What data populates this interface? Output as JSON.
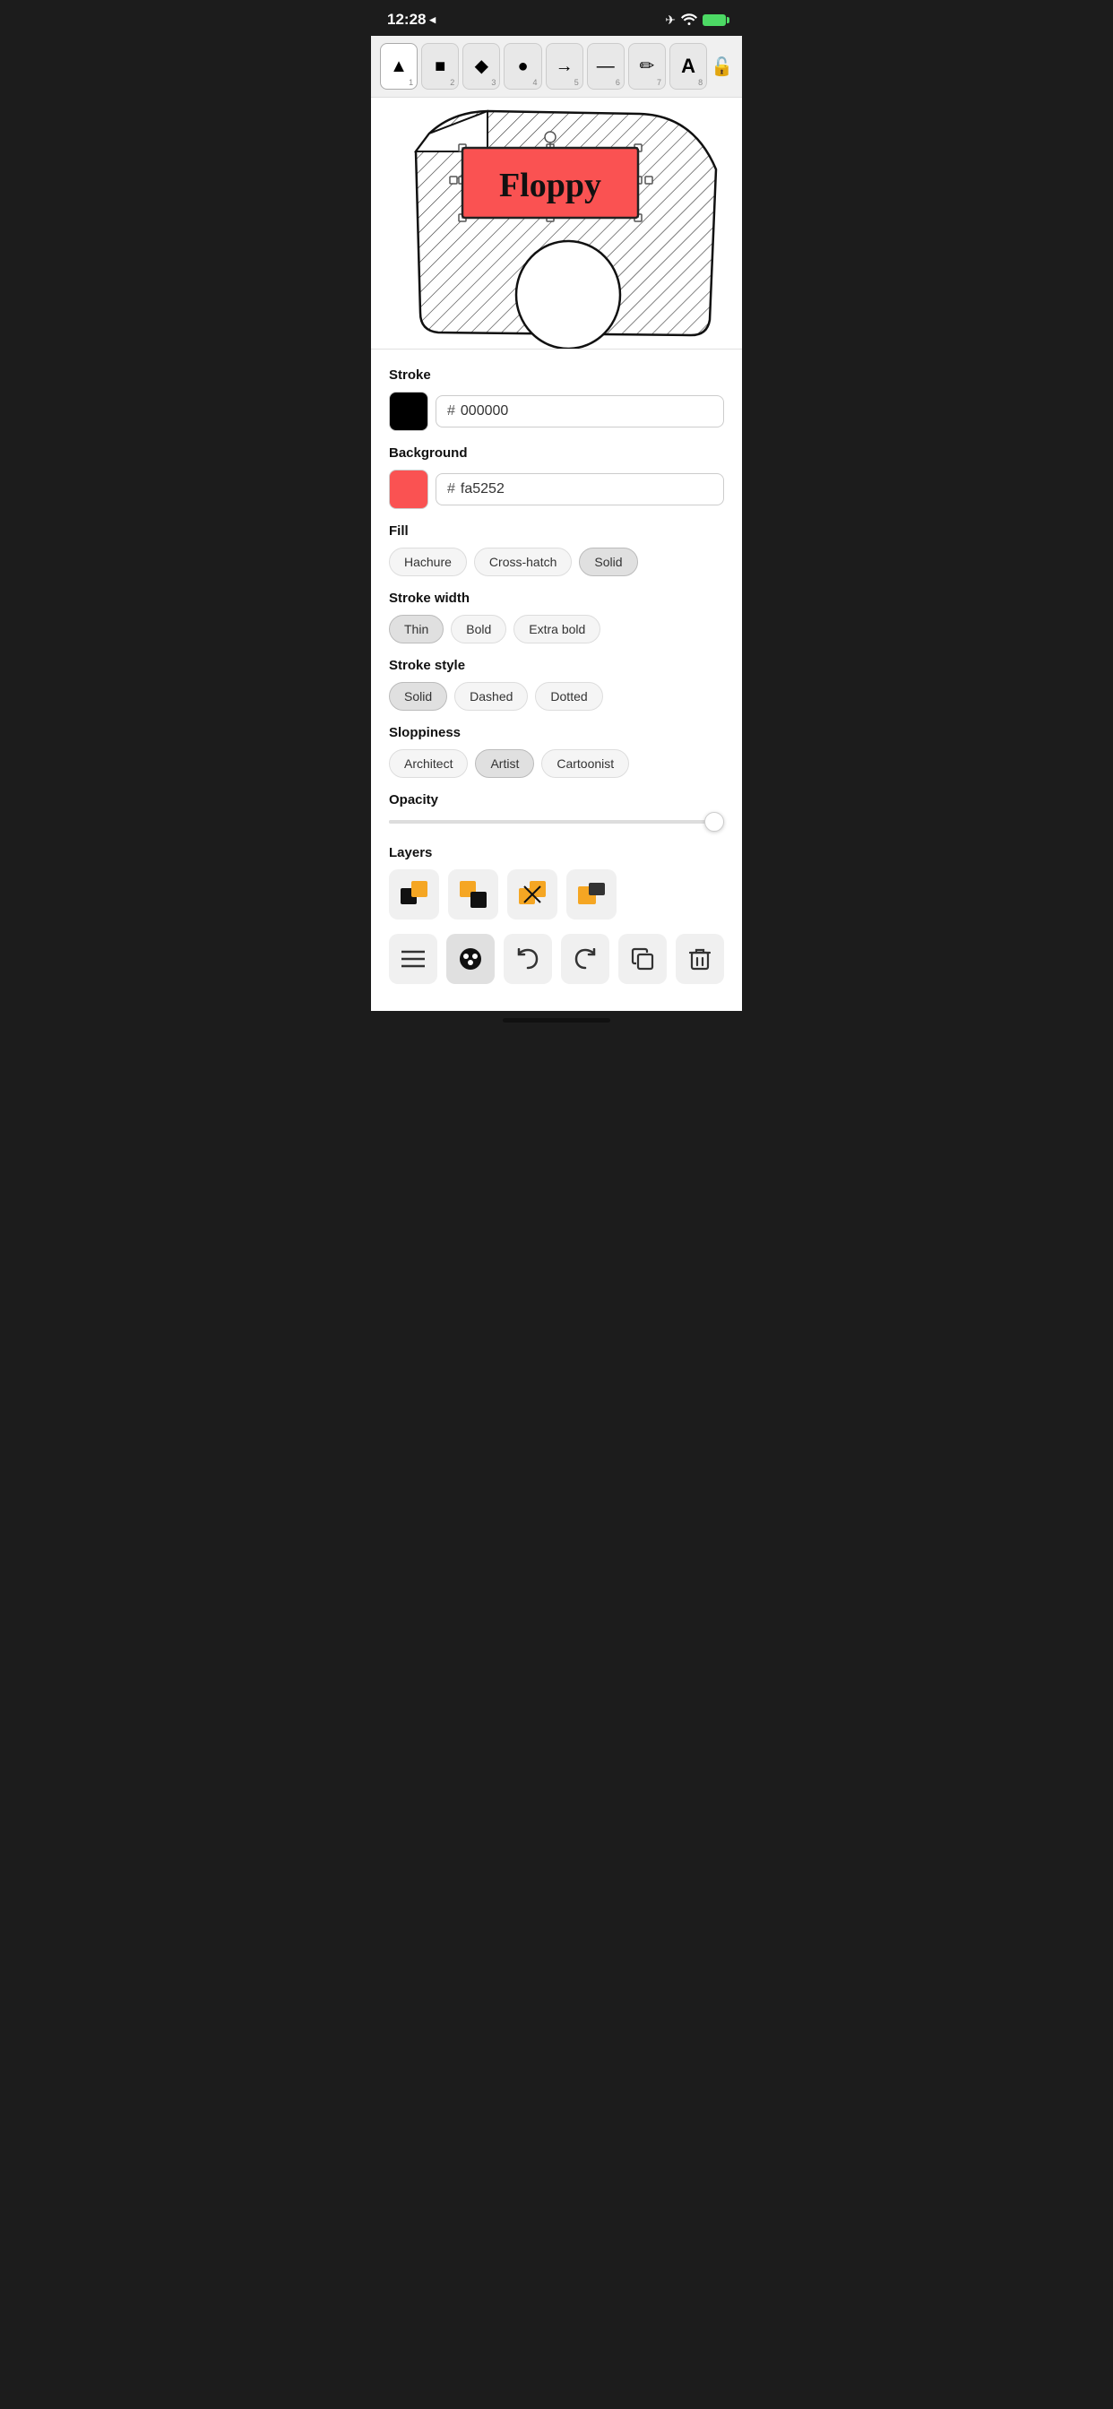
{
  "statusBar": {
    "time": "12:28",
    "locationIcon": "◂",
    "batteryPercent": "100"
  },
  "toolbar": {
    "tools": [
      {
        "id": "select",
        "icon": "▲",
        "number": "1",
        "active": true
      },
      {
        "id": "rectangle",
        "icon": "■",
        "number": "2",
        "active": false
      },
      {
        "id": "diamond",
        "icon": "◆",
        "number": "3",
        "active": false
      },
      {
        "id": "circle",
        "icon": "●",
        "number": "4",
        "active": false
      },
      {
        "id": "arrow",
        "icon": "→",
        "number": "5",
        "active": false
      },
      {
        "id": "line",
        "icon": "—",
        "number": "6",
        "active": false
      },
      {
        "id": "pencil",
        "icon": "✏",
        "number": "7",
        "active": false
      },
      {
        "id": "text",
        "icon": "A",
        "number": "8",
        "active": false
      }
    ],
    "lockLabel": "🔓"
  },
  "canvas": {
    "text": "Floppy"
  },
  "properties": {
    "strokeLabel": "Stroke",
    "strokeColor": "#000000",
    "strokeHex": "000000",
    "backgroundLabel": "Background",
    "bgColor": "#fa5252",
    "bgHex": "fa5252",
    "fillLabel": "Fill",
    "fillOptions": [
      {
        "label": "Hachure",
        "active": false
      },
      {
        "label": "Cross-hatch",
        "active": false
      },
      {
        "label": "Solid",
        "active": true
      }
    ],
    "strokeWidthLabel": "Stroke width",
    "strokeWidthOptions": [
      {
        "label": "Thin",
        "active": true
      },
      {
        "label": "Bold",
        "active": false
      },
      {
        "label": "Extra bold",
        "active": false
      }
    ],
    "strokeStyleLabel": "Stroke style",
    "strokeStyleOptions": [
      {
        "label": "Solid",
        "active": true
      },
      {
        "label": "Dashed",
        "active": false
      },
      {
        "label": "Dotted",
        "active": false
      }
    ],
    "sloppinessLabel": "Sloppiness",
    "sloppinessOptions": [
      {
        "label": "Architect",
        "active": false
      },
      {
        "label": "Artist",
        "active": true
      },
      {
        "label": "Cartoonist",
        "active": false
      }
    ],
    "opacityLabel": "Opacity",
    "opacityValue": 100,
    "layersLabel": "Layers"
  },
  "layers": {
    "icons": [
      "⬛🟧",
      "🟧⬛",
      "🟧🟧",
      "🟧◼"
    ]
  },
  "bottomToolbar": {
    "buttons": [
      {
        "id": "menu",
        "icon": "☰",
        "active": false
      },
      {
        "id": "style",
        "icon": "🎨",
        "active": true
      },
      {
        "id": "undo",
        "icon": "↩",
        "active": false
      },
      {
        "id": "redo",
        "icon": "↪",
        "active": false
      },
      {
        "id": "copy",
        "icon": "⧉",
        "active": false
      },
      {
        "id": "delete",
        "icon": "🗑",
        "active": false
      }
    ]
  }
}
